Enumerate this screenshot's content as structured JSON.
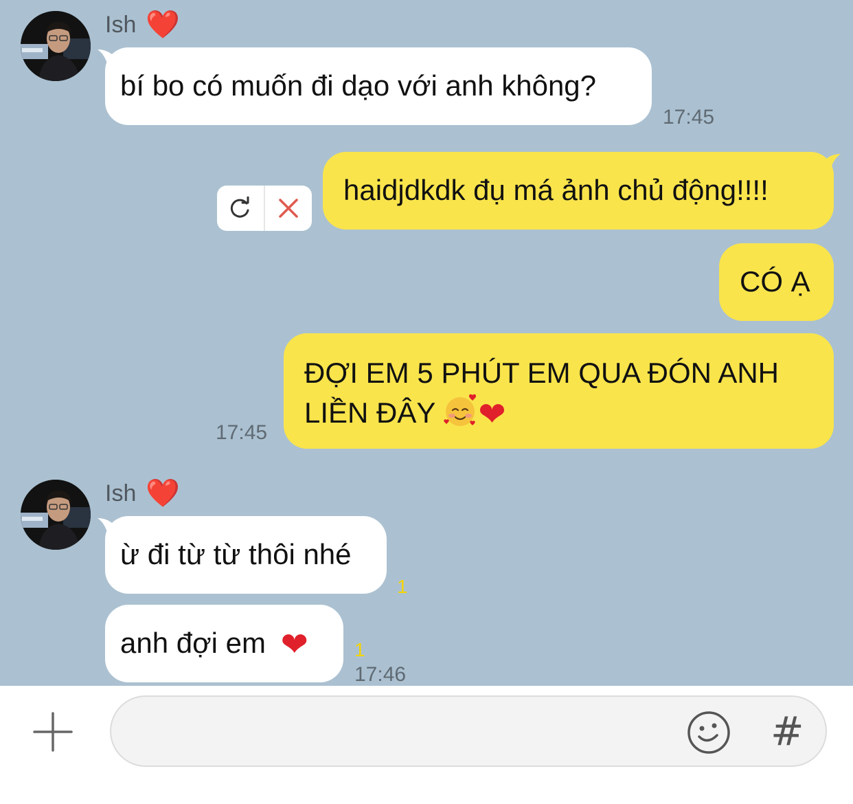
{
  "chat": {
    "sender_name": "Ish",
    "sender_heart": "❤️",
    "group1": {
      "msg1": "bí bo có muốn đi dạo với anh không?",
      "time": "17:45"
    },
    "outgoing": {
      "failed_msg": "haidjdkdk đụ má ảnh chủ động!!!!",
      "msg2": "CÓ Ạ",
      "msg3_line1": "ĐỢI EM 5 PHÚT EM QUA ĐÓN ANH",
      "msg3_line2": "LIỀN ĐÂY",
      "time": "17:45"
    },
    "group2": {
      "msg1": "ừ đi từ từ thôi nhé",
      "msg1_unread": "1",
      "msg2": "anh đợi em",
      "msg2_unread": "1",
      "time": "17:46"
    }
  },
  "colors": {
    "chat_bg": "#abc1d1",
    "incoming_bubble": "#ffffff",
    "outgoing_bubble": "#f9e44c",
    "unread_count": "#f5d400",
    "heart": "#e0202a"
  },
  "icons": {
    "retry": "retry-icon",
    "delete": "close-icon",
    "attach": "plus-icon",
    "emoticon": "smile-icon",
    "hashtag": "hash-icon"
  },
  "composer": {
    "hash_symbol": "#"
  }
}
